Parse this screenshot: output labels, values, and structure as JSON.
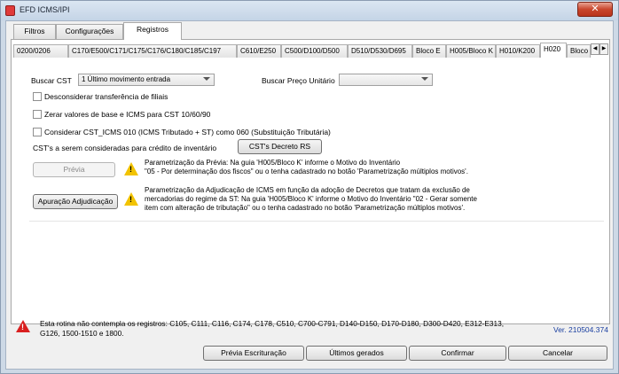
{
  "window": {
    "title": "EFD ICMS/IPI",
    "close_glyph": "✕"
  },
  "tabs": [
    {
      "label": "Filtros"
    },
    {
      "label": "Configurações"
    },
    {
      "label": "Registros"
    }
  ],
  "subtabs": [
    {
      "label": "0200/0206"
    },
    {
      "label": "C170/E500/C171/C175/C176/C180/C185/C197"
    },
    {
      "label": "C610/E250"
    },
    {
      "label": "C500/D100/D500"
    },
    {
      "label": "D510/D530/D695"
    },
    {
      "label": "Bloco E"
    },
    {
      "label": "H005/Bloco K"
    },
    {
      "label": "H010/K200"
    },
    {
      "label": "H020"
    },
    {
      "label": "Bloco"
    }
  ],
  "subtab_scroll": {
    "left": "◀",
    "right": "▶"
  },
  "buscar_cst": {
    "label": "Buscar CST",
    "value": "1 Último movimento entrada"
  },
  "buscar_preco": {
    "label": "Buscar Preço Unitário",
    "value": ""
  },
  "checkboxes": [
    {
      "label": "Desconsiderar transferência de filiais",
      "checked": false
    },
    {
      "label": "Zerar valores de base e ICMS para CST 10/60/90",
      "checked": false
    },
    {
      "label": "Considerar CST_ICMS 010 (ICMS Tributado + ST) como 060 (Substituição Tributária)",
      "checked": false
    }
  ],
  "cst_credito": {
    "label": "CST's a serem consideradas para crédito de inventário",
    "button": "CST's Decreto RS"
  },
  "previa": {
    "button": "Prévia",
    "line1": "Parametrização da Prévia: Na guia 'H005/Bloco K' informe o Motivo do Inventário",
    "line2": "\"05 - Por determinação dos fiscos\" ou o tenha cadastrado no botão 'Parametrização múltiplos motivos'."
  },
  "adjudicacao": {
    "button": "Apuração Adjudicação",
    "line1": "Parametrização da Adjudicação de ICMS em função da adoção de Decretos que tratam da exclusão de",
    "line2": "mercadorias do regime da ST: Na guia 'H005/Bloco K' informe o Motivo do Inventário \"02 - Gerar somente",
    "line3": "item com alteração de tributação\" ou o tenha cadastrado no botão 'Parametrização múltiplos motivos'."
  },
  "footer": {
    "note_line1": "Esta rotina não contempla os registros: C105, C111, C116, C174, C178, C510, C700-C791, D140-D150, D170-D180, D300-D420, E312-E313,",
    "note_line2": "G126, 1500-1510 e 1800.",
    "version": "Ver. 210504.374",
    "buttons": {
      "previa_escrituracao": "Prévia Escrituração",
      "ultimos_gerados": "Últimos gerados",
      "confirmar": "Confirmar",
      "cancelar": "Cancelar"
    }
  }
}
